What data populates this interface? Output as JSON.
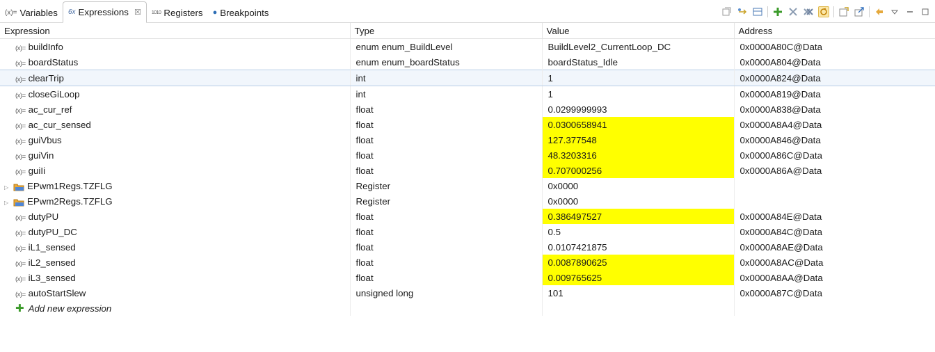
{
  "tabs": [
    {
      "icon": "(x)=",
      "label": "Variables"
    },
    {
      "icon": "6x",
      "label": "Expressions",
      "close": "☒"
    },
    {
      "icon": "1010",
      "label": "Registers"
    },
    {
      "icon": "●",
      "label": "Breakpoints"
    }
  ],
  "columns": [
    "Expression",
    "Type",
    "Value",
    "Address"
  ],
  "rows": [
    {
      "name": "buildInfo",
      "type": "enum enum_BuildLevel",
      "value": "BuildLevel2_CurrentLoop_DC",
      "address": "0x0000A80C@Data"
    },
    {
      "name": "boardStatus",
      "type": "enum enum_boardStatus",
      "value": "boardStatus_Idle",
      "address": "0x0000A804@Data"
    },
    {
      "name": "clearTrip",
      "type": "int",
      "value": "1",
      "address": "0x0000A824@Data"
    },
    {
      "name": "closeGiLoop",
      "type": "int",
      "value": "1",
      "address": "0x0000A819@Data"
    },
    {
      "name": "ac_cur_ref",
      "type": "float",
      "value": "0.0299999993",
      "address": "0x0000A838@Data"
    },
    {
      "name": "ac_cur_sensed",
      "type": "float",
      "value": "0.0300658941",
      "address": "0x0000A8A4@Data"
    },
    {
      "name": "guiVbus",
      "type": "float",
      "value": "127.377548",
      "address": "0x0000A846@Data"
    },
    {
      "name": "guiVin",
      "type": "float",
      "value": "48.3203316",
      "address": "0x0000A86C@Data"
    },
    {
      "name": "guiIi",
      "type": "float",
      "value": "0.707000256",
      "address": "0x0000A86A@Data"
    },
    {
      "name": "EPwm1Regs.TZFLG",
      "type": "Register",
      "value": "0x0000",
      "address": ""
    },
    {
      "name": "EPwm2Regs.TZFLG",
      "type": "Register",
      "value": "0x0000",
      "address": ""
    },
    {
      "name": "dutyPU",
      "type": "float",
      "value": "0.386497527",
      "address": "0x0000A84E@Data"
    },
    {
      "name": "dutyPU_DC",
      "type": "float",
      "value": "0.5",
      "address": "0x0000A84C@Data"
    },
    {
      "name": "iL1_sensed",
      "type": "float",
      "value": "0.0107421875",
      "address": "0x0000A8AE@Data"
    },
    {
      "name": "iL2_sensed",
      "type": "float",
      "value": "0.0087890625",
      "address": "0x0000A8AC@Data"
    },
    {
      "name": "iL3_sensed",
      "type": "float",
      "value": "0.009765625",
      "address": "0x0000A8AA@Data"
    },
    {
      "name": "autoStartSlew",
      "type": "unsigned long",
      "value": "101",
      "address": "0x0000A87C@Data"
    }
  ],
  "add_expression_label": "Add new expression",
  "colors": {
    "changed_highlight": "#ffff00",
    "selection": "#f1f6fc"
  }
}
